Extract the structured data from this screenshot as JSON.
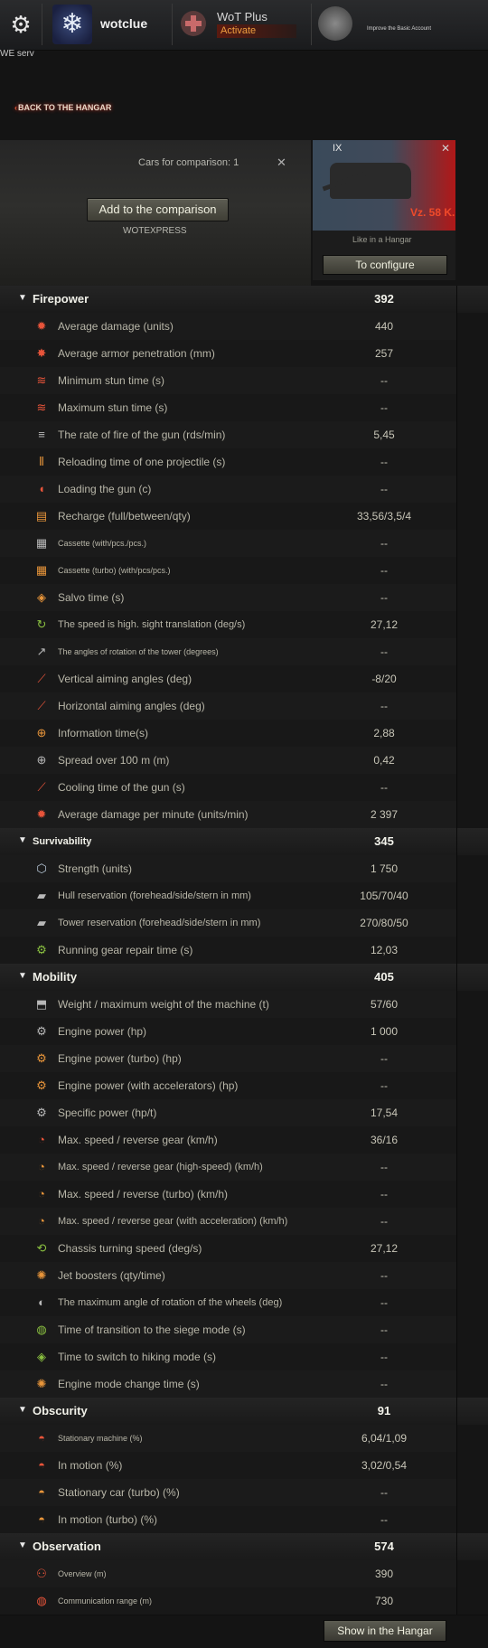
{
  "topbar": {
    "username": "wotclue",
    "plus_title": "WoT Plus",
    "plus_activate": "Activate",
    "premium_text": "Improve the Basic Account"
  },
  "server": "WE serv",
  "back_link": "BACK TO THE HANGAR",
  "compare": {
    "count_label": "Cars for comparison: 1",
    "add_button": "Add to the comparison",
    "server_name": "WOTEXPRESS"
  },
  "tank": {
    "tier": "IX",
    "name": "Vz. 58 K.",
    "subtitle": "Like in a Hangar",
    "configure_button": "To configure"
  },
  "sections": [
    {
      "title": "Firepower",
      "value": "392",
      "rows": [
        {
          "icon": "damage-icon",
          "label": "Average damage (units)",
          "value": "440"
        },
        {
          "icon": "penetration-icon",
          "label": "Average armor penetration (mm)",
          "value": "257"
        },
        {
          "icon": "min-stun-icon",
          "label": "Minimum stun time (s)",
          "value": "--"
        },
        {
          "icon": "max-stun-icon",
          "label": "Maximum stun time (s)",
          "value": "--"
        },
        {
          "icon": "rate-of-fire-icon",
          "label": "The rate of fire of the gun (rds/min)",
          "value": "5,45"
        },
        {
          "icon": "reload-projectile-icon",
          "label": "Reloading time of one projectile (s)",
          "value": "--"
        },
        {
          "icon": "loading-icon",
          "label": "Loading the gun (c)",
          "value": "--"
        },
        {
          "icon": "recharge-icon",
          "label": "Recharge (full/between/qty)",
          "value": "33,56/3,5/4"
        },
        {
          "icon": "cassette-icon",
          "label": "Cassette (with/pcs./pcs.)",
          "value": "--"
        },
        {
          "icon": "cassette-turbo-icon",
          "label": "Cassette (turbo) (with/pcs/pcs.)",
          "value": "--"
        },
        {
          "icon": "salvo-icon",
          "label": "Salvo time (s)",
          "value": "--"
        },
        {
          "icon": "sight-speed-icon",
          "label": "The speed is high. sight translation (deg/s)",
          "value": "27,12"
        },
        {
          "icon": "turret-rotation-icon",
          "label": "The angles of rotation of the tower (degrees)",
          "value": "--"
        },
        {
          "icon": "vertical-angles-icon",
          "label": "Vertical aiming angles (deg)",
          "value": "-8/20"
        },
        {
          "icon": "horizontal-angles-icon",
          "label": "Horizontal aiming angles (deg)",
          "value": "--"
        },
        {
          "icon": "aim-time-icon",
          "label": "Information time(s)",
          "value": "2,88"
        },
        {
          "icon": "dispersion-icon",
          "label": "Spread over 100 m (m)",
          "value": "0,42"
        },
        {
          "icon": "cooling-icon",
          "label": "Cooling time of the gun (s)",
          "value": "--"
        },
        {
          "icon": "dpm-icon",
          "label": "Average damage per minute (units/min)",
          "value": "2 397"
        }
      ]
    },
    {
      "title": "Survivability",
      "value": "345",
      "rows": [
        {
          "icon": "strength-icon",
          "label": "Strength (units)",
          "value": "1 750"
        },
        {
          "icon": "hull-armor-icon",
          "label": "Hull reservation (forehead/side/stern in mm)",
          "value": "105/70/40"
        },
        {
          "icon": "turret-armor-icon",
          "label": "Tower reservation (forehead/side/stern in mm)",
          "value": "270/80/50"
        },
        {
          "icon": "repair-icon",
          "label": "Running gear repair time (s)",
          "value": "12,03"
        }
      ]
    },
    {
      "title": "Mobility",
      "value": "405",
      "rows": [
        {
          "icon": "weight-icon",
          "label": "Weight / maximum weight of the machine (t)",
          "value": "57/60"
        },
        {
          "icon": "engine-icon",
          "label": "Engine power (hp)",
          "value": "1 000"
        },
        {
          "icon": "engine-turbo-icon",
          "label": "Engine power (turbo) (hp)",
          "value": "--"
        },
        {
          "icon": "engine-accel-icon",
          "label": "Engine power (with accelerators) (hp)",
          "value": "--"
        },
        {
          "icon": "specific-power-icon",
          "label": "Specific power (hp/t)",
          "value": "17,54"
        },
        {
          "icon": "speed-icon",
          "label": "Max. speed / reverse gear (km/h)",
          "value": "36/16"
        },
        {
          "icon": "speed-highspeed-icon",
          "label": "Max. speed / reverse gear (high-speed) (km/h)",
          "value": "--"
        },
        {
          "icon": "speed-turbo-icon",
          "label": "Max. speed / reverse (turbo) (km/h)",
          "value": "--"
        },
        {
          "icon": "speed-accel-icon",
          "label": "Max. speed / reverse gear (with acceleration) (km/h)",
          "value": "--"
        },
        {
          "icon": "chassis-turn-icon",
          "label": "Chassis turning speed (deg/s)",
          "value": "27,12"
        },
        {
          "icon": "jet-booster-icon",
          "label": "Jet boosters (qty/time)",
          "value": "--"
        },
        {
          "icon": "wheel-angle-icon",
          "label": "The maximum angle of rotation of the wheels (deg)",
          "value": "--"
        },
        {
          "icon": "siege-mode-icon",
          "label": "Time of transition to the siege mode (s)",
          "value": "--"
        },
        {
          "icon": "hiking-mode-icon",
          "label": "Time to switch to hiking mode (s)",
          "value": "--"
        },
        {
          "icon": "engine-mode-icon",
          "label": "Engine mode change time (s)",
          "value": "--"
        }
      ]
    },
    {
      "title": "Obscurity",
      "value": "91",
      "rows": [
        {
          "icon": "stationary-camo-icon",
          "label": "Stationary machine (%)",
          "value": "6,04/1,09"
        },
        {
          "icon": "moving-camo-icon",
          "label": "In motion (%)",
          "value": "3,02/0,54"
        },
        {
          "icon": "stationary-turbo-camo-icon",
          "label": "Stationary car (turbo) (%)",
          "value": "--"
        },
        {
          "icon": "moving-turbo-camo-icon",
          "label": "In motion (turbo) (%)",
          "value": "--"
        }
      ]
    },
    {
      "title": "Observation",
      "value": "574",
      "rows": [
        {
          "icon": "view-range-icon",
          "label": "Overview (m)",
          "value": "390"
        },
        {
          "icon": "radio-range-icon",
          "label": "Communication range (m)",
          "value": "730"
        }
      ]
    }
  ],
  "footer": {
    "show_hangar_button": "Show in the Hangar"
  },
  "colors": {
    "accent_red": "#e8543a",
    "accent_orange": "#e8953a",
    "tank_name": "#f04a2a"
  }
}
